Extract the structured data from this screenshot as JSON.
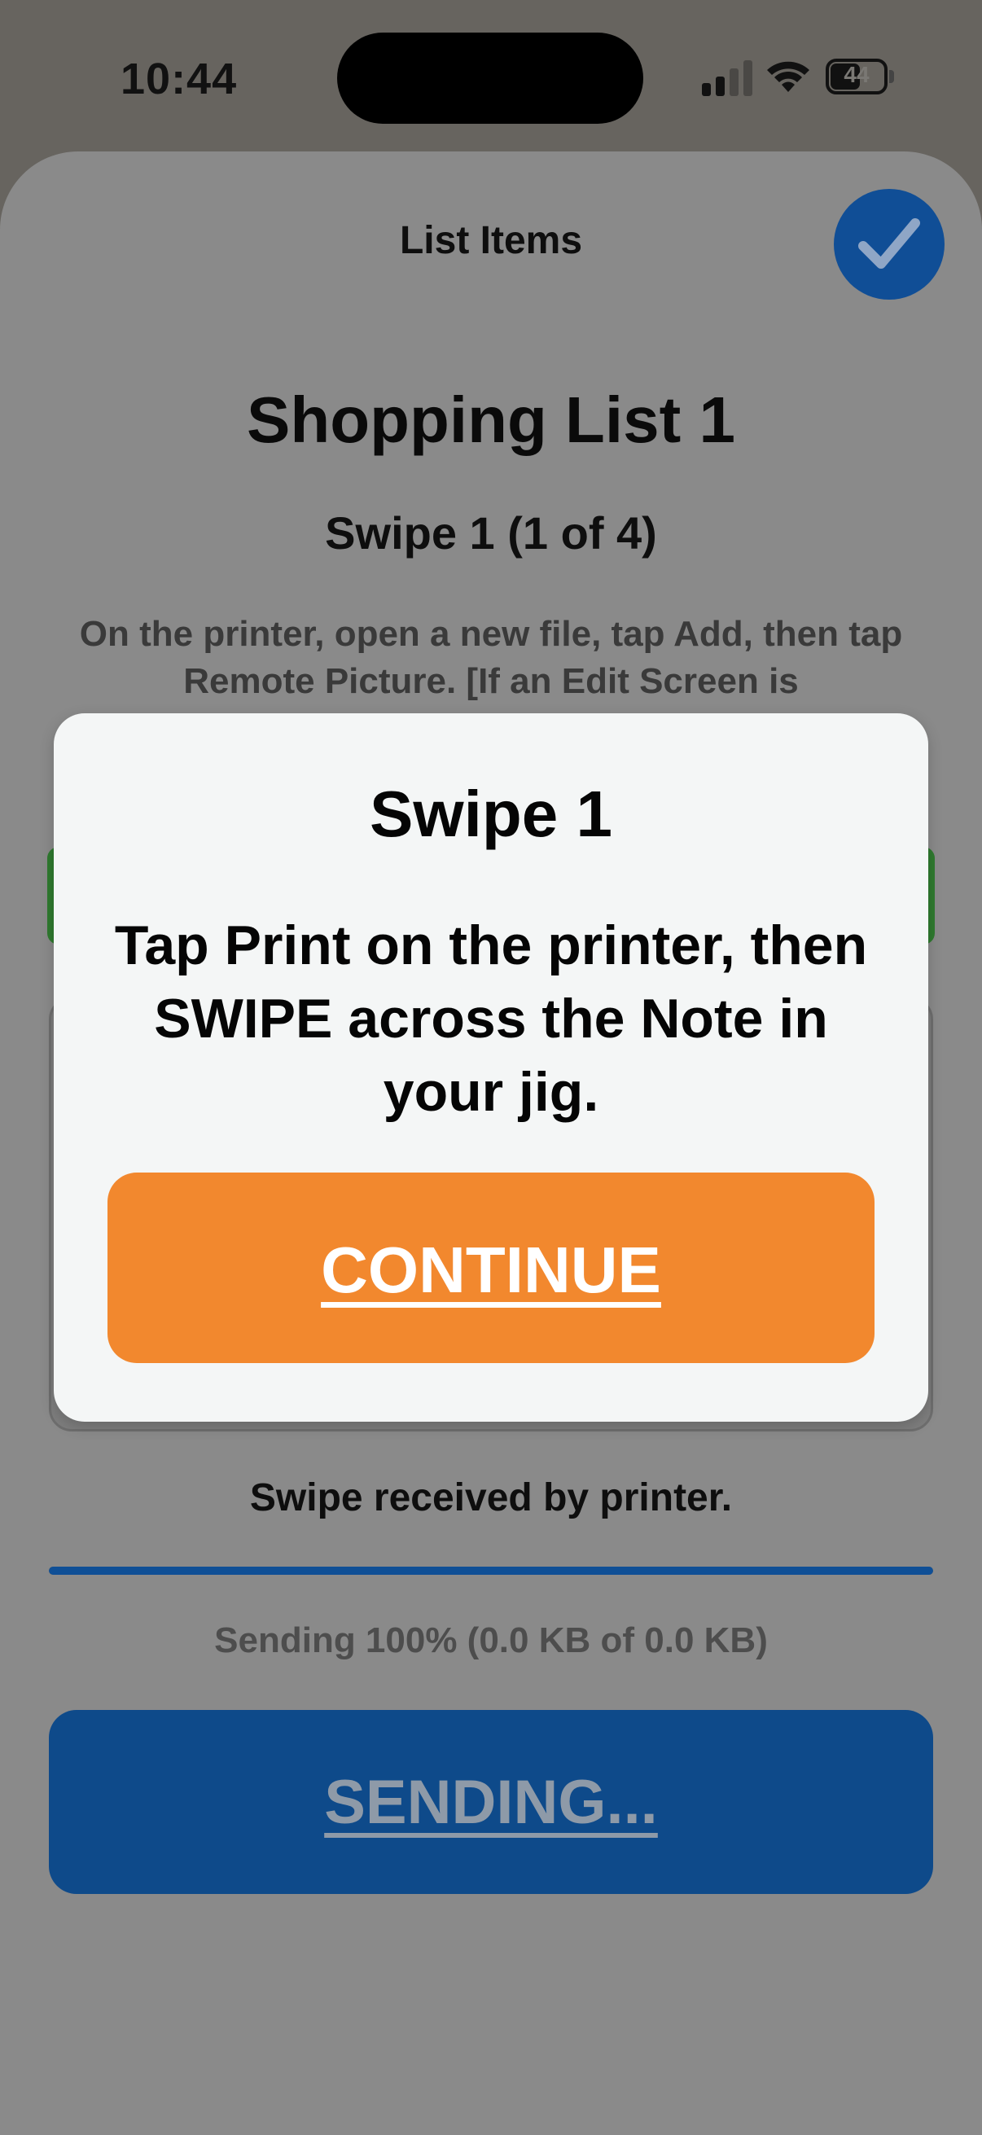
{
  "status_bar": {
    "time": "10:44",
    "battery_percent": "44",
    "signal_bars_active": 2,
    "signal_bars_total": 4
  },
  "sheet": {
    "title": "List Items",
    "done_icon": "checkmark-icon",
    "list_name": "Shopping List 1",
    "swipe_heading": "Swipe 1 (1 of 4)",
    "instructions": "On the printer, open a new file, tap Add, then tap Remote Picture. [If an Edit Screen is",
    "received_text": "Swipe received by printer.",
    "progress_percent": 100,
    "sending_status": "Sending 100% (0.0 KB of 0.0 KB)",
    "sending_button_label": "SENDING..."
  },
  "dialog": {
    "title": "Swipe 1",
    "body": "Tap Print on the printer, then SWIPE across the Note in your jig.",
    "continue_label": "CONTINUE"
  },
  "colors": {
    "accent_blue": "#104e96",
    "continue_orange": "#f2882e",
    "overlay_gray": "#8a8a8a"
  }
}
